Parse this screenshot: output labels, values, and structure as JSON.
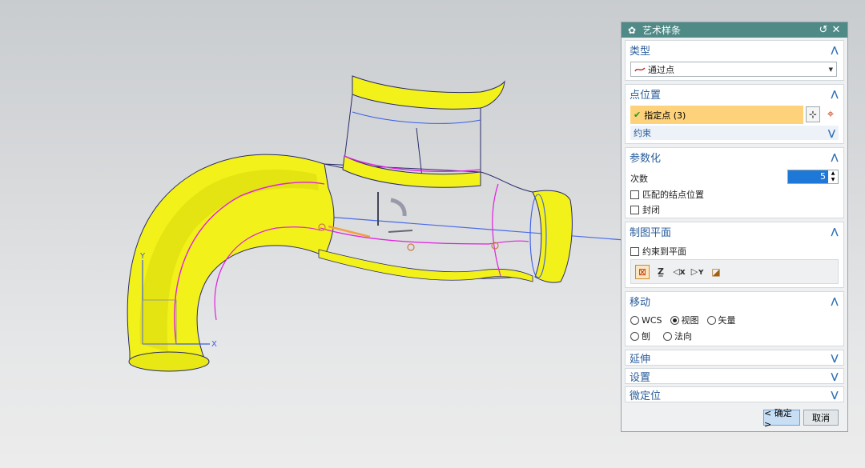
{
  "viewport": {
    "axis_x_label": "X",
    "axis_y_label": "Y",
    "colors": {
      "pipe": "#f2f21a",
      "curve": "#e020e0",
      "spline": "#3b5ee8",
      "edge": "#2a2a6a"
    }
  },
  "dialog": {
    "title": "艺术样条",
    "icons": {
      "title": "gear-icon",
      "reset": "reset-icon",
      "close": "close-icon"
    },
    "sections": {
      "type": {
        "label": "类型",
        "selected": "通过点",
        "icon": "spline-type-icon"
      },
      "point_position": {
        "label": "点位置",
        "specify_label": "指定点 (3)",
        "constraint_label": "约束"
      },
      "parameterization": {
        "label": "参数化",
        "degree_label": "次数",
        "degree_value": "5",
        "match_knots_label": "匹配的结点位置",
        "closed_label": "封闭"
      },
      "drawing_plane": {
        "label": "制图平面",
        "constrain_label": "约束到平面"
      },
      "move": {
        "label": "移动",
        "options": [
          "WCS",
          "视图",
          "矢量",
          "刨",
          "法向"
        ],
        "selected": "视图"
      },
      "extend": {
        "label": "延伸"
      },
      "settings": {
        "label": "设置"
      },
      "fine_position": {
        "label": "微定位"
      }
    },
    "buttons": {
      "ok": "< 确定 >",
      "cancel": "取消"
    },
    "colors": {
      "title_bar": "#4f8a87",
      "section_title": "#2a5d9c",
      "highlight": "#fdd27a",
      "check": "#1e9b1e"
    }
  }
}
